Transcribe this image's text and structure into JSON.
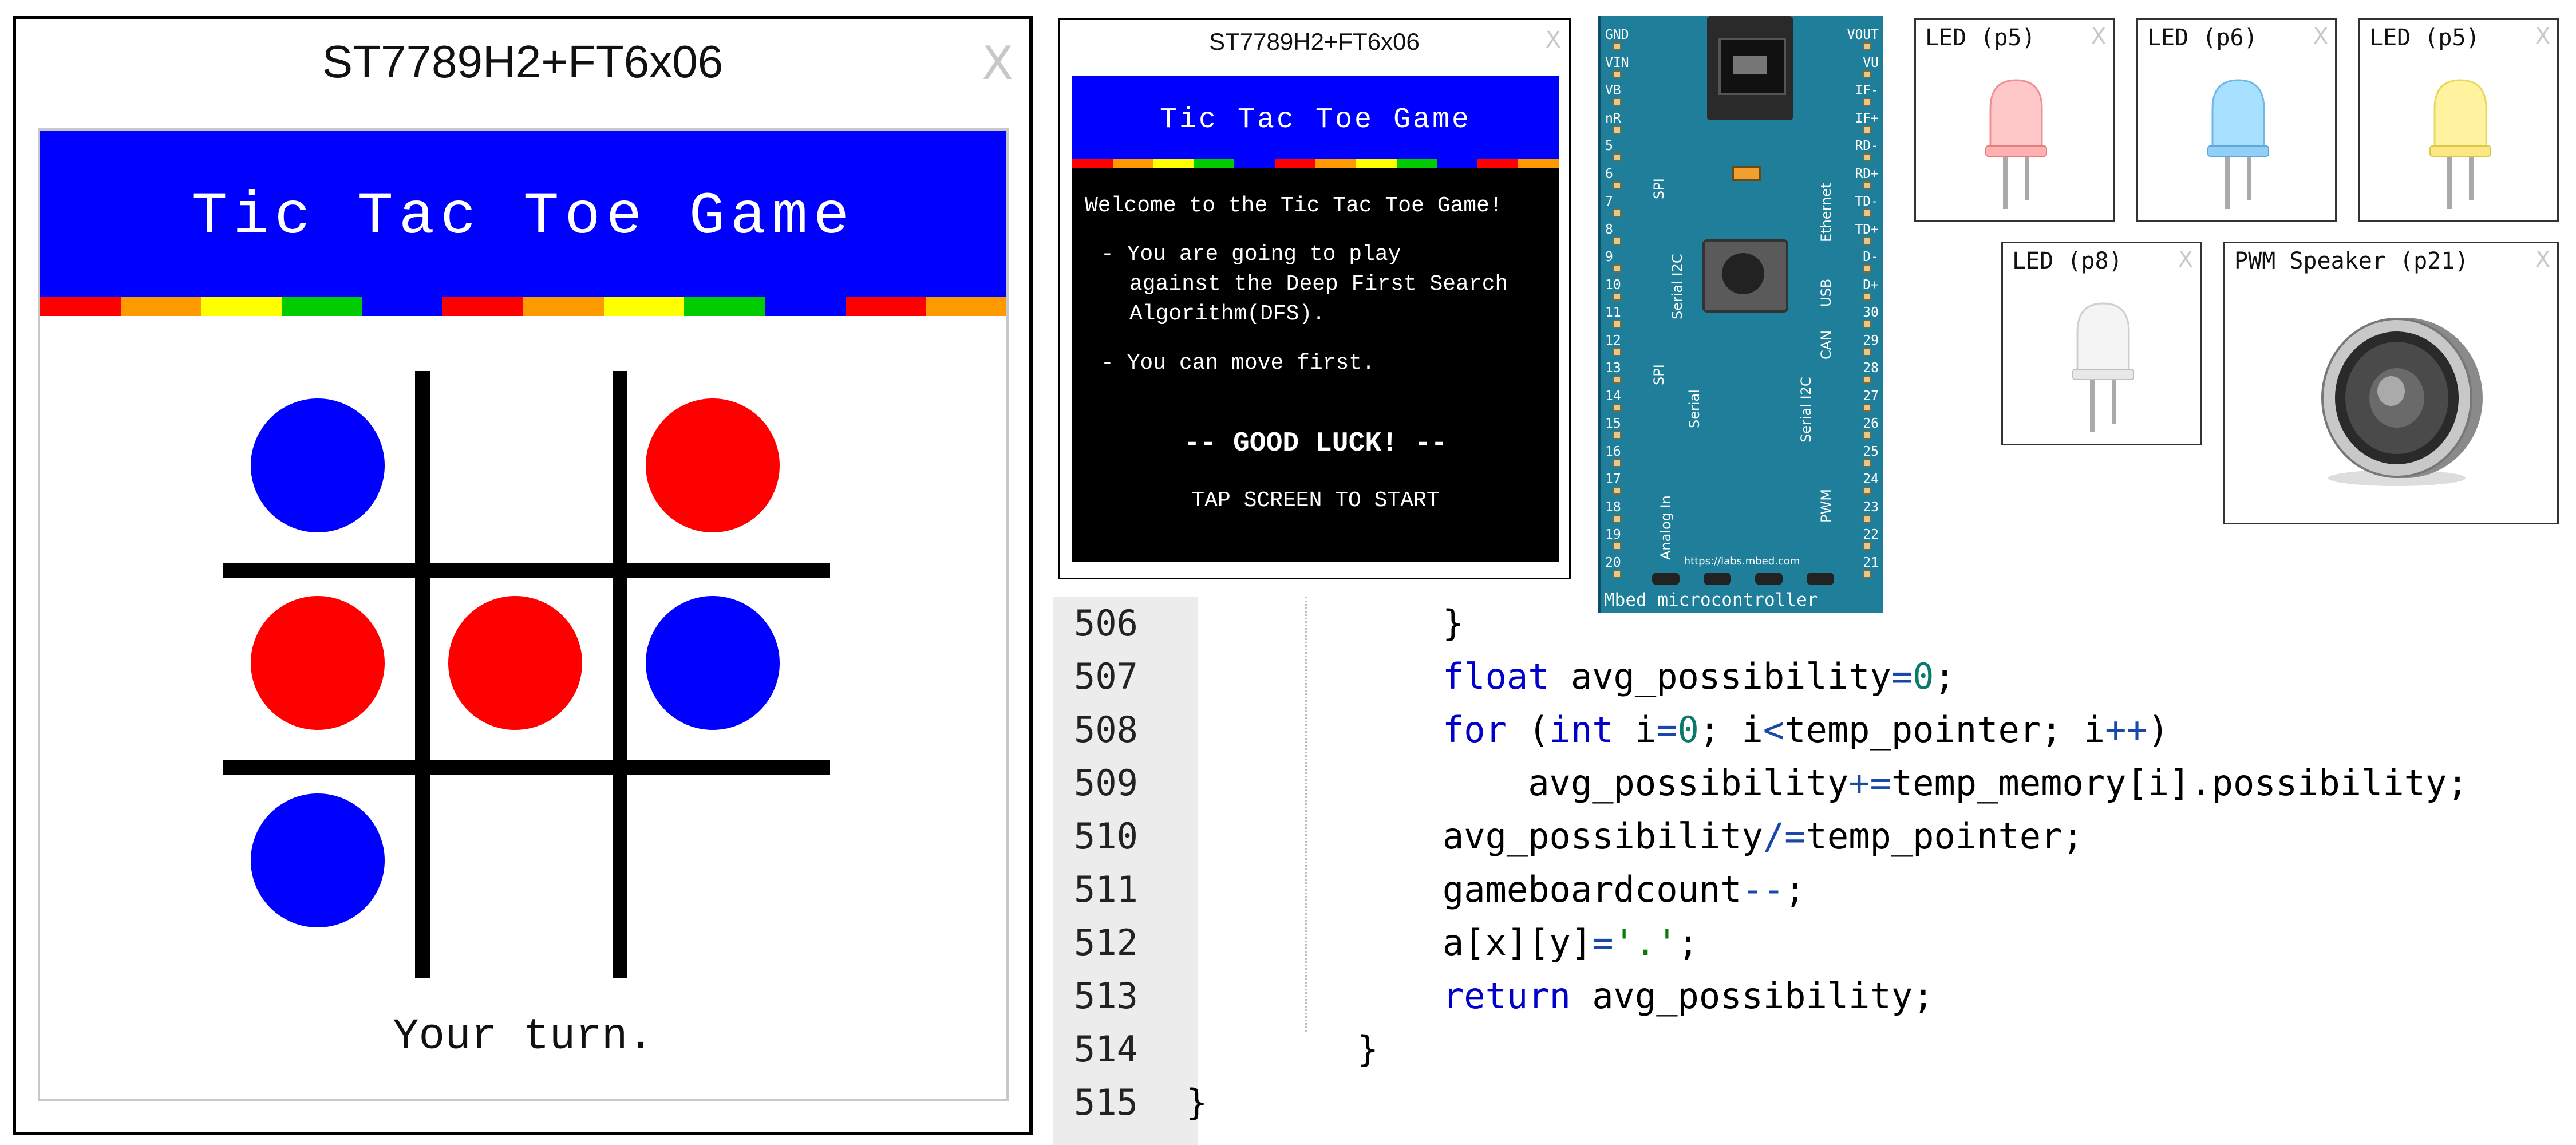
{
  "main_display": {
    "window_title": "ST7789H2+FT6x06",
    "close": "X",
    "banner_title": "Tic Tac Toe Game",
    "status": "Your turn.",
    "board": [
      [
        "blue",
        "empty",
        "red"
      ],
      [
        "red",
        "red",
        "blue"
      ],
      [
        "blue",
        "empty",
        "empty"
      ]
    ]
  },
  "mini_display": {
    "window_title": "ST7789H2+FT6x06",
    "close": "X",
    "banner_title": "Tic Tac Toe Game",
    "welcome": "Welcome to the Tic Tac Toe Game!",
    "bullet1_l1": "- You are going to play",
    "bullet1_l2": "against the Deep First Search",
    "bullet1_l3": "Algorithm(DFS).",
    "bullet2": "- You can move first.",
    "good_luck": "-- GOOD LUCK! --",
    "tap": "TAP SCREEN TO START"
  },
  "colors": {
    "banner_blue": "#0000ff",
    "piece_blue": "#0000ff",
    "piece_red": "#ff0000",
    "stripe": [
      "#ff0000",
      "#ff9900",
      "#ffff00",
      "#00cc00",
      "#0000ff",
      "#ff0000",
      "#ff9900",
      "#ffff00",
      "#00cc00",
      "#0000ff",
      "#ff0000",
      "#ff9900"
    ],
    "board_teal": "#1f7f9a"
  },
  "mbed": {
    "caption": "Mbed microcontroller",
    "url": "https://labs.mbed.com",
    "left_pins": [
      "GND",
      "VIN",
      "VB",
      "nR",
      "5",
      "6",
      "7",
      "8",
      "9",
      "10",
      "11",
      "12",
      "13",
      "14",
      "15",
      "16",
      "17",
      "18",
      "19",
      "20"
    ],
    "right_pins": [
      "VOUT",
      "VU",
      "IF-",
      "IF+",
      "RD-",
      "RD+",
      "TD-",
      "TD+",
      "D-",
      "D+",
      "30",
      "29",
      "28",
      "27",
      "26",
      "25",
      "24",
      "23",
      "22",
      "21"
    ],
    "groups": {
      "spi1": "SPI",
      "serial_i2c": "Serial I2C",
      "spi2": "SPI",
      "serial": "Serial",
      "analog": "Analog In",
      "ethernet": "Ethernet",
      "usb": "USB",
      "can": "CAN",
      "serial_i2c_r": "Serial I2C",
      "pwm": "PWM"
    }
  },
  "peripherals": {
    "led_red": "LED (p5)",
    "led_blue": "LED (p6)",
    "led_yellow": "LED (p5)",
    "led_white": "LED (p8)",
    "speaker": "PWM Speaker (p21)",
    "close": "X"
  },
  "code": {
    "lines": [
      {
        "n": "506",
        "text": "            }"
      },
      {
        "n": "507",
        "text": "            float avg_possibility=0;"
      },
      {
        "n": "508",
        "text": "            for (int i=0; i<temp_pointer; i++)"
      },
      {
        "n": "509",
        "text": "                avg_possibility+=temp_memory[i].possibility;"
      },
      {
        "n": "510",
        "text": "            avg_possibility/=temp_pointer;"
      },
      {
        "n": "511",
        "text": "            gameboardcount--;"
      },
      {
        "n": "512",
        "text": "            a[x][y]='.';"
      },
      {
        "n": "513",
        "text": "            return avg_possibility;"
      },
      {
        "n": "514",
        "text": "        }"
      },
      {
        "n": "515",
        "text": "}"
      }
    ]
  }
}
